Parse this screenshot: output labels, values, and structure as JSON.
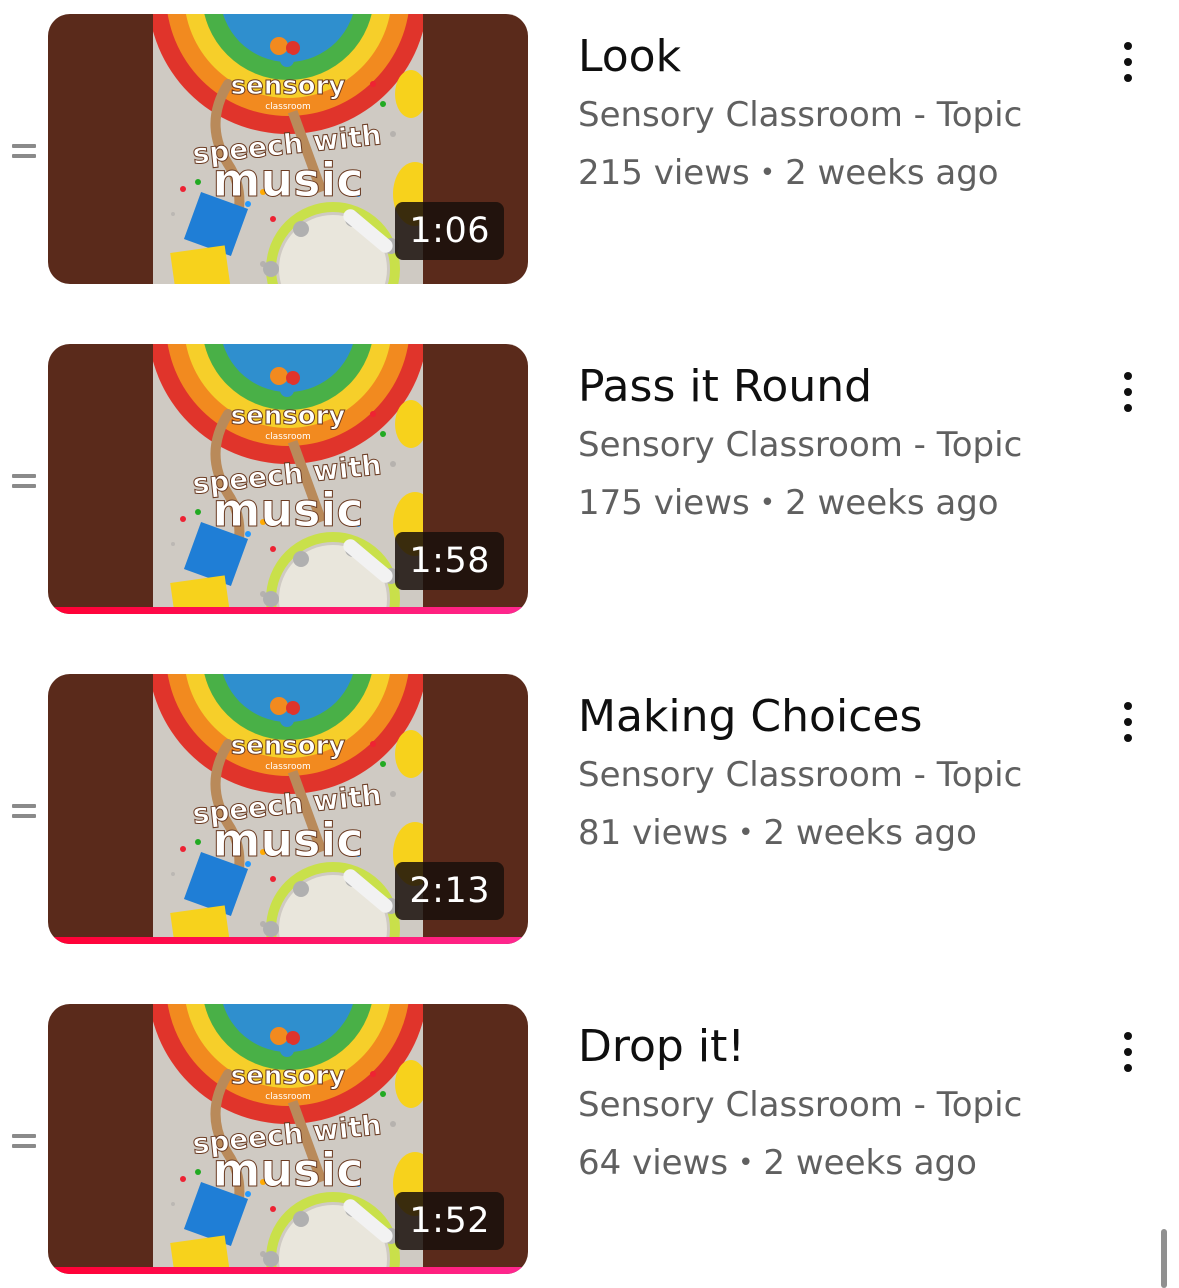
{
  "playlist": {
    "items": [
      {
        "title": "Look",
        "channel": "Sensory Classroom - Topic",
        "views": "215 views",
        "separator": "•",
        "age": "2 weeks ago",
        "duration": "1:06",
        "watched_fraction": 0
      },
      {
        "title": "Pass it Round",
        "channel": "Sensory Classroom - Topic",
        "views": "175 views",
        "separator": "•",
        "age": "2 weeks ago",
        "duration": "1:58",
        "watched_fraction": 1.0
      },
      {
        "title": "Making Choices",
        "channel": "Sensory Classroom - Topic",
        "views": "81 views",
        "separator": "•",
        "age": "2 weeks ago",
        "duration": "2:13",
        "watched_fraction": 1.0
      },
      {
        "title": "Drop it!",
        "channel": "Sensory Classroom - Topic",
        "views": "64 views",
        "separator": "•",
        "age": "2 weeks ago",
        "duration": "1:52",
        "watched_fraction": 1.0
      }
    ]
  },
  "thumbnail_art": {
    "brand": "sensory",
    "brand_sub": "classroom",
    "line1": "speech with",
    "line2": "music"
  },
  "colors": {
    "thumbnail_bg": "#5a2a1b",
    "progress": "#ff0033",
    "title": "#0f0f0f",
    "secondary": "#606060"
  }
}
